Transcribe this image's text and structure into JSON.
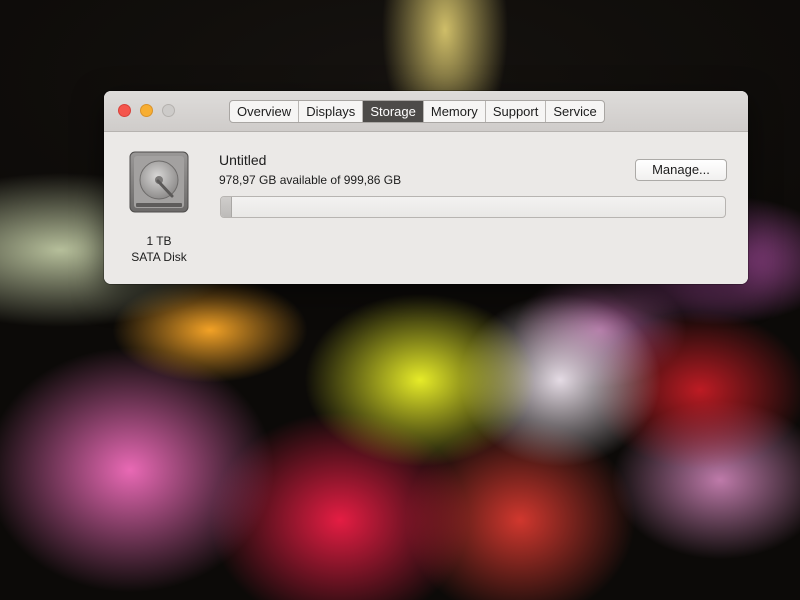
{
  "window": {
    "tabs": [
      {
        "label": "Overview"
      },
      {
        "label": "Displays"
      },
      {
        "label": "Storage"
      },
      {
        "label": "Memory"
      },
      {
        "label": "Support"
      },
      {
        "label": "Service"
      }
    ],
    "selected_tab": "Storage"
  },
  "disk": {
    "icon": "hard-drive-icon",
    "capacity_label": "1 TB",
    "type_label": "SATA Disk"
  },
  "volume": {
    "name": "Untitled",
    "availability_text": "978,97 GB available of 999,86 GB",
    "used_fraction": 0.021
  },
  "buttons": {
    "manage_label": "Manage..."
  },
  "colors": {
    "close": "#f4554c",
    "minimize": "#f7ae32",
    "zoom": "#cdcbc9",
    "selected_tab": "#4d4b49"
  }
}
